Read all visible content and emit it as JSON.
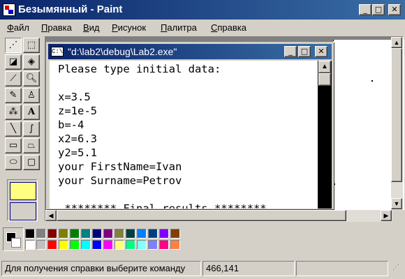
{
  "window": {
    "title": "Безымянный - Paint",
    "buttons": {
      "minimize": "_",
      "maximize": "□",
      "close": "✕"
    }
  },
  "menu": {
    "items": [
      "Файл",
      "Правка",
      "Вид",
      "Рисунок",
      "Палитра",
      "Справка"
    ]
  },
  "toolbox": {
    "tools": [
      {
        "name": "free-select-icon",
        "glyph": "⋰"
      },
      {
        "name": "rect-select-icon",
        "glyph": "⬚"
      },
      {
        "name": "eraser-icon",
        "glyph": "◪"
      },
      {
        "name": "fill-icon",
        "glyph": "◈"
      },
      {
        "name": "color-picker-icon",
        "glyph": "⟋"
      },
      {
        "name": "magnifier-icon",
        "glyph": "🔍︎"
      },
      {
        "name": "pencil-icon",
        "glyph": "✎"
      },
      {
        "name": "brush-icon",
        "glyph": "♙"
      },
      {
        "name": "airbrush-icon",
        "glyph": "⁂"
      },
      {
        "name": "text-icon",
        "glyph": "A"
      },
      {
        "name": "line-icon",
        "glyph": "╲"
      },
      {
        "name": "curve-icon",
        "glyph": "∫"
      },
      {
        "name": "rectangle-icon",
        "glyph": "▭"
      },
      {
        "name": "polygon-icon",
        "glyph": "⏢"
      },
      {
        "name": "ellipse-icon",
        "glyph": "⬭"
      },
      {
        "name": "rounded-rect-icon",
        "glyph": "▢"
      }
    ]
  },
  "console": {
    "title": "\"d:\\lab2\\debug\\Lab2.exe\"",
    "icon_text": "C:\\",
    "lines": [
      "Please type initial data:",
      "",
      "x=3.5",
      "z=1e-5",
      "b=-4",
      "x2=6.3",
      "y2=5.1",
      "your FirstName=Ivan",
      "your Surname=Petrov",
      "",
      " ******** Final results ********"
    ]
  },
  "palette": {
    "colors": [
      "#000000",
      "#808080",
      "#800000",
      "#808000",
      "#008000",
      "#008080",
      "#000080",
      "#800080",
      "#808040",
      "#004040",
      "#0080ff",
      "#004080",
      "#8000ff",
      "#804000",
      "#ffffff",
      "#c0c0c0",
      "#ff0000",
      "#ffff00",
      "#00ff00",
      "#00ffff",
      "#0000ff",
      "#ff00ff",
      "#ffff80",
      "#00ff80",
      "#80ffff",
      "#8080ff",
      "#ff0080",
      "#ff8040"
    ],
    "foreground": "#000000",
    "background": "#ffffff"
  },
  "status": {
    "help_text": "Для получения справки выберите команду",
    "coordinates": "466,141"
  }
}
